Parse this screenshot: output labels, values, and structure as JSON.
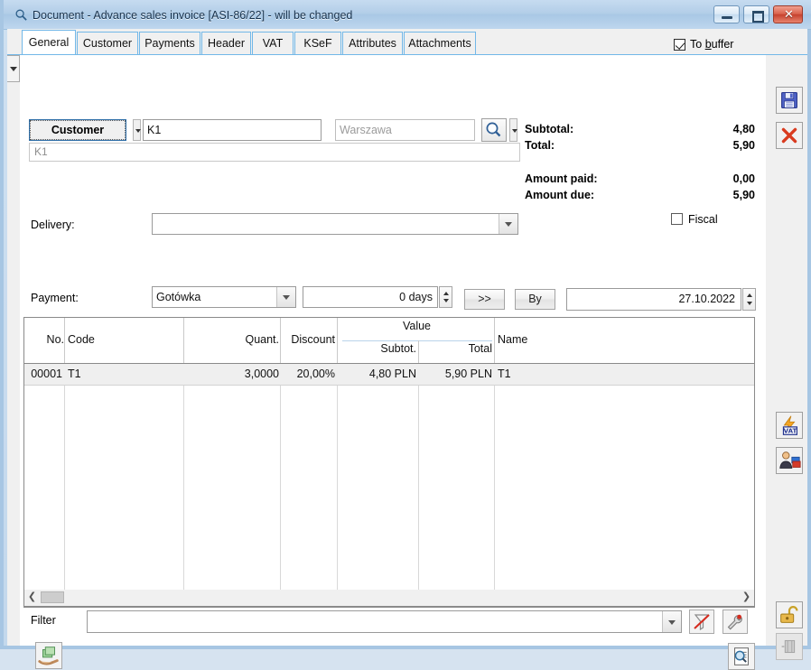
{
  "window": {
    "title": "Document - Advance sales invoice [ASI-86/22]  - will be changed",
    "icon": "document-search-icon",
    "minimize_label": "Minimize",
    "maximize_label": "Maximize",
    "close_label": "✕"
  },
  "tabs": [
    {
      "label": "General",
      "active": true
    },
    {
      "label": "Customer",
      "active": false
    },
    {
      "label": "Payments",
      "active": false
    },
    {
      "label": "Header",
      "active": false
    },
    {
      "label": "VAT",
      "active": false
    },
    {
      "label": "KSeF",
      "active": false
    },
    {
      "label": "Attributes",
      "active": false
    },
    {
      "label": "Attachments",
      "active": false
    }
  ],
  "to_buffer": {
    "label_pre": "To ",
    "label_accel": "b",
    "label_post": "uffer",
    "checked": true
  },
  "customer": {
    "button_label": "Customer",
    "code_value": "K1",
    "city_placeholder": "Warszawa",
    "name_value": "K1",
    "search_icon": "magnifier-icon"
  },
  "totals": {
    "subtotal_label": "Subtotal:",
    "subtotal_value": "4,80",
    "total_label": "Total:",
    "total_value": "5,90",
    "amount_paid_label": "Amount paid:",
    "amount_paid_value": "0,00",
    "amount_due_label": "Amount due:",
    "amount_due_value": "5,90",
    "fiscal_label": "Fiscal",
    "fiscal_checked": false
  },
  "delivery": {
    "label": "Delivery:",
    "value": ""
  },
  "payment": {
    "label": "Payment:",
    "method_value": "Gotówka",
    "days_value": "0 days",
    "more_button": ">>",
    "by_button": "By",
    "date_value": "27.10.2022"
  },
  "grid": {
    "group_header": "Value",
    "columns": [
      "No.",
      "Code",
      "Quant.",
      "Discount",
      "Subtot.",
      "Total",
      "Name"
    ],
    "rows": [
      {
        "no": "00001",
        "code": "T1",
        "quant": "3,0000",
        "discount": "20,00%",
        "subtotal": "4,80 PLN",
        "total": "5,90 PLN",
        "name": "T1"
      }
    ]
  },
  "filter": {
    "label": "Filter",
    "value": "",
    "clear_icon": "filter-clear-icon",
    "build_icon": "filter-builder-icon"
  },
  "bottom_toolbar": {
    "money_icon": "money-in-hand-icon",
    "preview_icon": "document-preview-icon"
  },
  "right_toolbar": [
    {
      "name": "save-button",
      "icon": "floppy-save-icon"
    },
    {
      "name": "cancel-button",
      "icon": "red-x-icon"
    },
    {
      "name": "vat-button",
      "icon": "vat-icon"
    },
    {
      "name": "contractor-button",
      "icon": "person-icon"
    },
    {
      "name": "lock-button",
      "icon": "open-padlock-icon"
    },
    {
      "name": "pin-button",
      "icon": "pin-icon-disabled"
    }
  ],
  "colors": {
    "accent": "#72b8e8",
    "title_text": "#16314c",
    "close_button": "#c4402c",
    "row_highlight": "#efefef"
  }
}
